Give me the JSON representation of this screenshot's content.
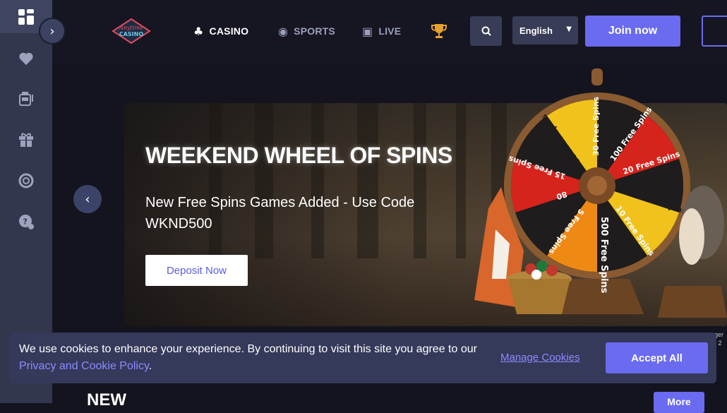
{
  "sidebar": {
    "toggle_icon": "chevron-right-icon",
    "items": [
      {
        "icon": "dashboard-icon"
      },
      {
        "icon": "heart-icon"
      },
      {
        "icon": "slot-machine-icon"
      },
      {
        "icon": "gift-icon"
      },
      {
        "icon": "lifebuoy-icon"
      },
      {
        "icon": "help-chat-icon"
      }
    ]
  },
  "header": {
    "logo_text": "Anytime Casino",
    "nav": [
      {
        "label": "CASINO",
        "icon": "cards-icon",
        "active": true
      },
      {
        "label": "SPORTS",
        "icon": "ball-icon",
        "active": false
      },
      {
        "label": "LIVE",
        "icon": "live-icon",
        "active": false
      }
    ],
    "trophy_icon": "trophy-icon",
    "search_icon": "search-icon",
    "language": "English",
    "join_label": "Join now"
  },
  "hero": {
    "title": "WEEKEND WHEEL OF SPINS",
    "subtitle": "New Free Spins Games Added - Use Code WKND500",
    "cta_label": "Deposit Now",
    "wheel_segments": [
      "30 Free Spins",
      "100 Free Spins",
      "20 Free Spins",
      "300 Free Spins",
      "10 Free Spins",
      "500 Free Spins",
      "5 Free Spins",
      "80",
      "15 Free Spins",
      "50 Free Spins"
    ]
  },
  "cookie_banner": {
    "text_before": "We use cookies to enhance your experience. By continuing to visit this site you agree to our ",
    "policy_link": "Privacy and Cookie Policy",
    "text_after": ".",
    "manage_label": "Manage Cookies",
    "accept_label": "Accept All"
  },
  "section": {
    "title": "NEW",
    "more_label": "More"
  },
  "edge_note": {
    "line1": "ger",
    "line2": "r 2"
  },
  "colors": {
    "accent": "#6a6bf0",
    "sidebar": "#33374d",
    "background": "#14141f"
  }
}
